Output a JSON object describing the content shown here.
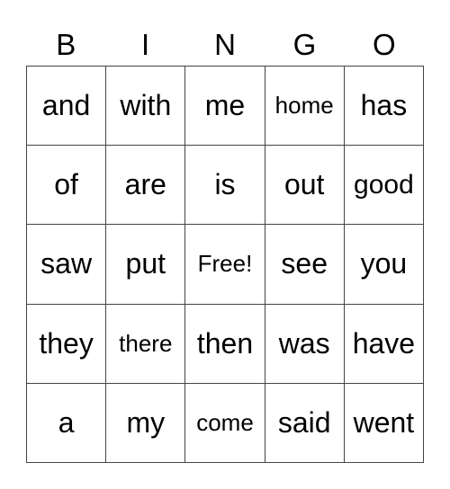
{
  "header": [
    "B",
    "I",
    "N",
    "G",
    "O"
  ],
  "cells": [
    "and",
    "with",
    "me",
    "home",
    "has",
    "of",
    "are",
    "is",
    "out",
    "good",
    "saw",
    "put",
    "Free!",
    "see",
    "you",
    "they",
    "there",
    "then",
    "was",
    "have",
    "a",
    "my",
    "come",
    "said",
    "went"
  ]
}
